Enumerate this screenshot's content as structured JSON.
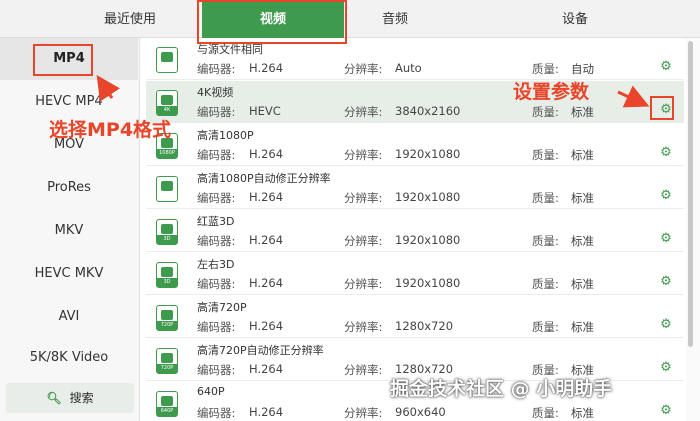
{
  "tabs": {
    "recent": "最近使用",
    "video": "视频",
    "audio": "音频",
    "device": "设备"
  },
  "categories": [
    "MP4",
    "HEVC MP4",
    "MOV",
    "ProRes",
    "MKV",
    "HEVC MKV",
    "AVI",
    "5K/8K Video"
  ],
  "search_label": "搜索",
  "field_labels": {
    "encoder": "编码器:",
    "resolution": "分辨率:",
    "quality": "质量:"
  },
  "formats": [
    {
      "name": "与源文件相同",
      "encoder": "H.264",
      "resolution": "Auto",
      "quality": "自动",
      "tag": ""
    },
    {
      "name": "4K视频",
      "encoder": "HEVC",
      "resolution": "3840x2160",
      "quality": "标准",
      "tag": "4K"
    },
    {
      "name": "高清1080P",
      "encoder": "H.264",
      "resolution": "1920x1080",
      "quality": "标准",
      "tag": "1080P"
    },
    {
      "name": "高清1080P自动修正分辨率",
      "encoder": "H.264",
      "resolution": "1920x1080",
      "quality": "标准",
      "tag": ""
    },
    {
      "name": "红蓝3D",
      "encoder": "H.264",
      "resolution": "1920x1080",
      "quality": "标准",
      "tag": "3D"
    },
    {
      "name": "左右3D",
      "encoder": "H.264",
      "resolution": "1920x1080",
      "quality": "标准",
      "tag": "3D"
    },
    {
      "name": "高清720P",
      "encoder": "H.264",
      "resolution": "1280x720",
      "quality": "标准",
      "tag": "720P"
    },
    {
      "name": "高清720P自动修正分辨率",
      "encoder": "H.264",
      "resolution": "1280x720",
      "quality": "标准",
      "tag": "720P"
    },
    {
      "name": "640P",
      "encoder": "H.264",
      "resolution": "960x640",
      "quality": "标准",
      "tag": "640P"
    }
  ],
  "annotations": {
    "select_mp4": "选择MP4格式",
    "set_params": "设置参数"
  },
  "watermark": "掘金技术社区 @ 小明助手",
  "colors": {
    "accent": "#3e9a4c",
    "annotation": "#e8452a",
    "highlight_row": "#e7eee8"
  }
}
